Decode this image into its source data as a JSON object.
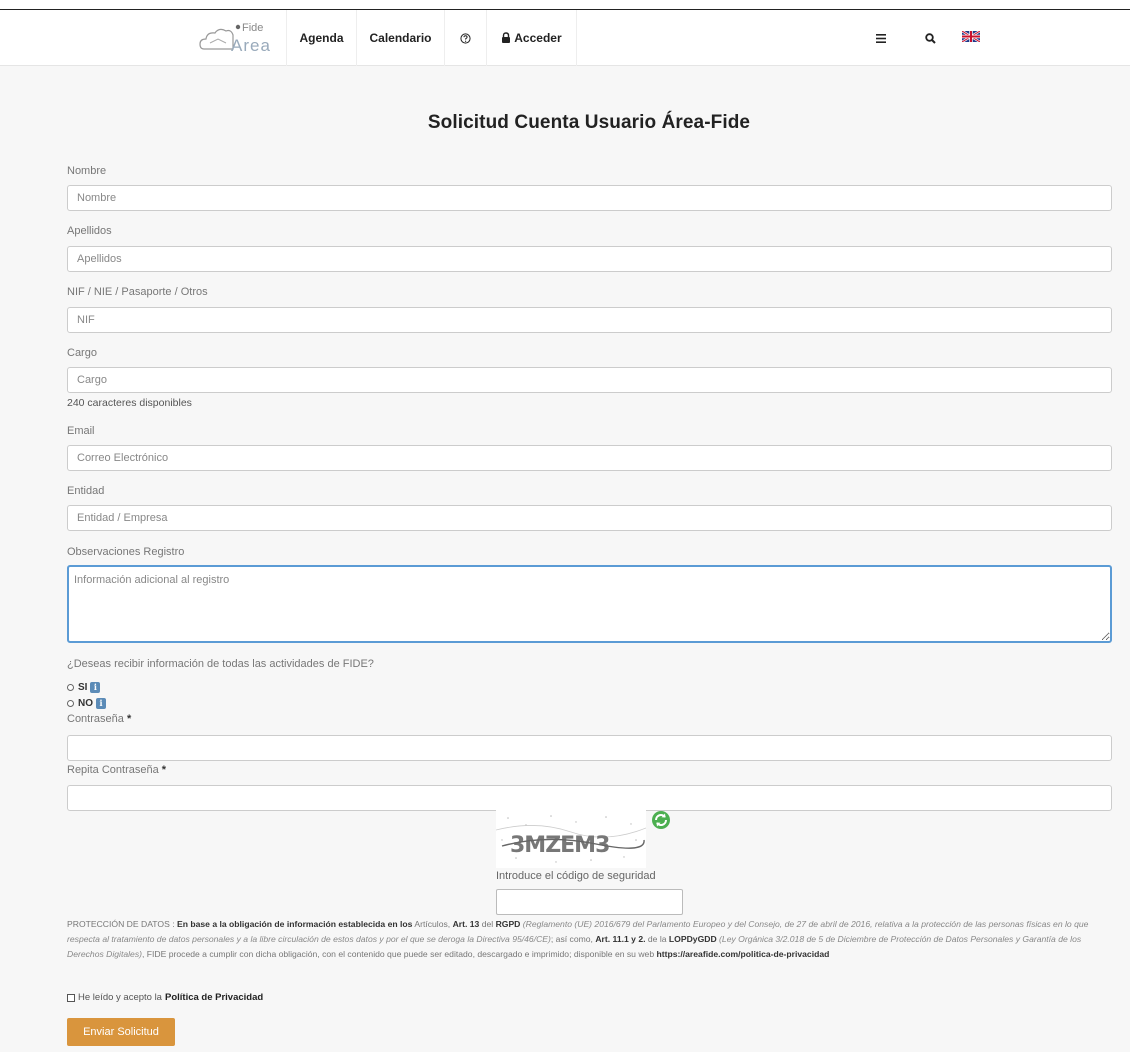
{
  "nav": {
    "logo_text_top": "Fide",
    "logo_text_bottom": "Area",
    "items": [
      "Agenda",
      "Calendario"
    ],
    "help_icon": "help-circle-icon",
    "login_label": "Acceder",
    "menu_icon": "hamburger-icon",
    "search_icon": "search-icon",
    "lang_icon": "uk-flag-icon"
  },
  "form": {
    "title": "Solicitud Cuenta Usuario Área-Fide",
    "nombre_label": "Nombre",
    "nombre_placeholder": "Nombre",
    "apellidos_label": "Apellidos",
    "apellidos_placeholder": "Apellidos",
    "nif_label": "NIF / NIE / Pasaporte / Otros",
    "nif_placeholder": "NIF",
    "cargo_label": "Cargo",
    "cargo_placeholder": "Cargo",
    "cargo_hint": "240 caracteres disponibles",
    "email_label": "Email",
    "email_placeholder": "Correo Electrónico",
    "entidad_label": "Entidad",
    "entidad_placeholder": "Entidad / Empresa",
    "obs_label": "Observaciones Registro",
    "obs_placeholder": "Información adicional al registro",
    "question": "¿Deseas recibir información de todas las actividades de FIDE?",
    "option_yes": "SI",
    "option_no": "NO",
    "info_glyph": "i",
    "password_label": "Contraseña",
    "password_repeat_label": "Repita Contraseña",
    "required_mark": "*",
    "captcha_text": "3MZEM3",
    "captcha_label": "Introduce el código de seguridad"
  },
  "privacy": {
    "p1": "PROTECCIÓN DE DATOS : ",
    "p2": "En base a la obligación de información establecida en los",
    "p3": " Artículos, ",
    "p4": "Art. 13",
    "p5": " del ",
    "p6": "RGPD",
    "p7": " (Reglamento (UE) 2016/679 del Parlamento Europeo y del Consejo, de 27 de abril de 2016, relativa a la protección de las personas físicas en lo que respecta al tratamiento de datos personales y a la libre circulación de estos datos y por el que se deroga la Directiva 95/46/CE)",
    "p8": "; así como, ",
    "p9": "Art. 11.1 y 2.",
    "p10": " de la ",
    "p11": "LOPDyGDD",
    "p12": " (Ley Orgánica 3/2.018 de 5 de Diciembre de Protección de Datos Personales y Garantía de los Derechos Digitales)",
    "p13": ", FIDE procede a cumplir con dicha obligación, con el contenido que puede ser editado, descargado e imprimido; disponible en su web ",
    "p14": "https://areafide.com/politica-de-privacidad",
    "accept_text": "He leído y acepto la",
    "accept_link": "Política de Privacidad",
    "submit": "Enviar Solicitud"
  },
  "colors": {
    "accent": "#d9953d",
    "focus_border": "#5b9bd5",
    "info_badge": "#5b8bb7"
  }
}
